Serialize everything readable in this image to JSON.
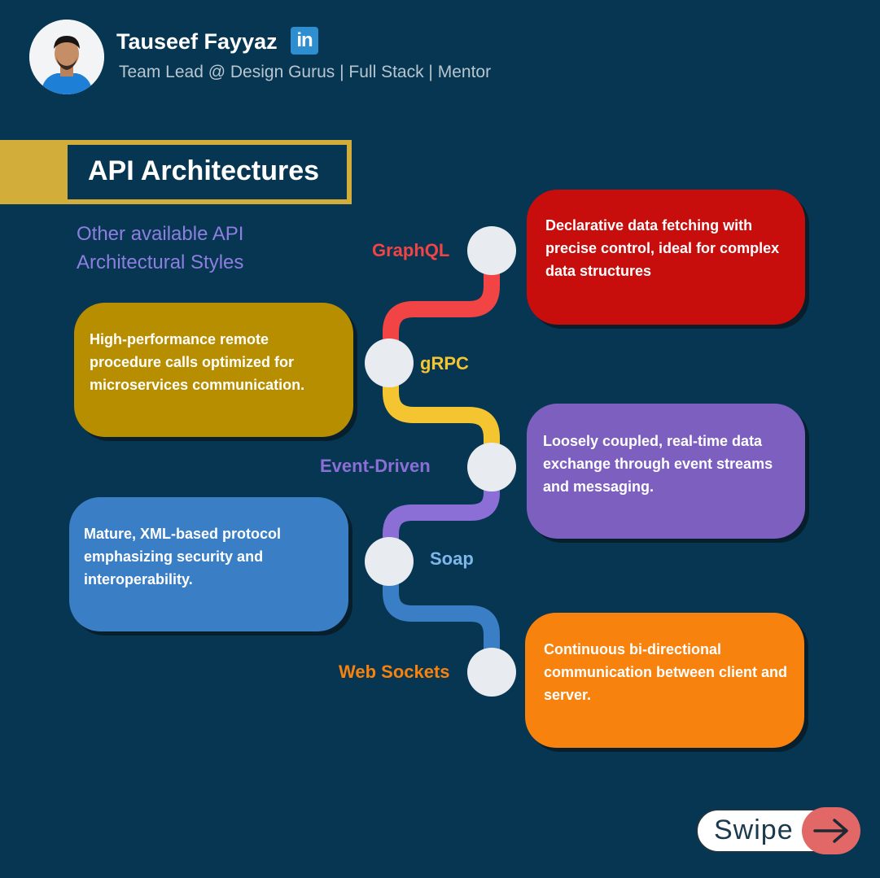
{
  "author": {
    "name": "Tauseef Fayyaz",
    "linkedin_badge": "in",
    "tagline": "Team Lead @ Design Gurus | Full Stack | Mentor"
  },
  "title": "API Architectures",
  "subtitle": "Other available API Architectural Styles",
  "nodes": [
    {
      "label": "GraphQL",
      "description": "Declarative data fetching with precise control, ideal for complex data structures",
      "color": "#c80d0d",
      "label_color": "#f24444",
      "path_color": "#f24444"
    },
    {
      "label": "gRPC",
      "description": "High-performance remote procedure calls optimized for microservices communication.",
      "color": "#b68e00",
      "label_color": "#f4c531",
      "path_color": "#f4c531"
    },
    {
      "label": "Event-Driven",
      "description": "Loosely coupled, real-time data exchange through event streams and messaging.",
      "color": "#7d5fc0",
      "label_color": "#8c6fd6",
      "path_color": "#8c6fd6"
    },
    {
      "label": "Soap",
      "description": "Mature, XML-based protocol emphasizing security and interoperability.",
      "color": "#3a7ec6",
      "label_color": "#7fb7ea",
      "path_color": "#3a7ec6"
    },
    {
      "label": "Web Sockets",
      "description": "Continuous bi-directional communication between client and server.",
      "color": "#f7820d",
      "label_color": "#f7820d",
      "path_color": "#3a7ec6"
    }
  ],
  "swipe": {
    "label": "Swipe",
    "icon": "arrow-right-icon"
  },
  "colors": {
    "background": "#073652",
    "banner_gold": "#d3ad39",
    "node": "#e8ebef"
  }
}
